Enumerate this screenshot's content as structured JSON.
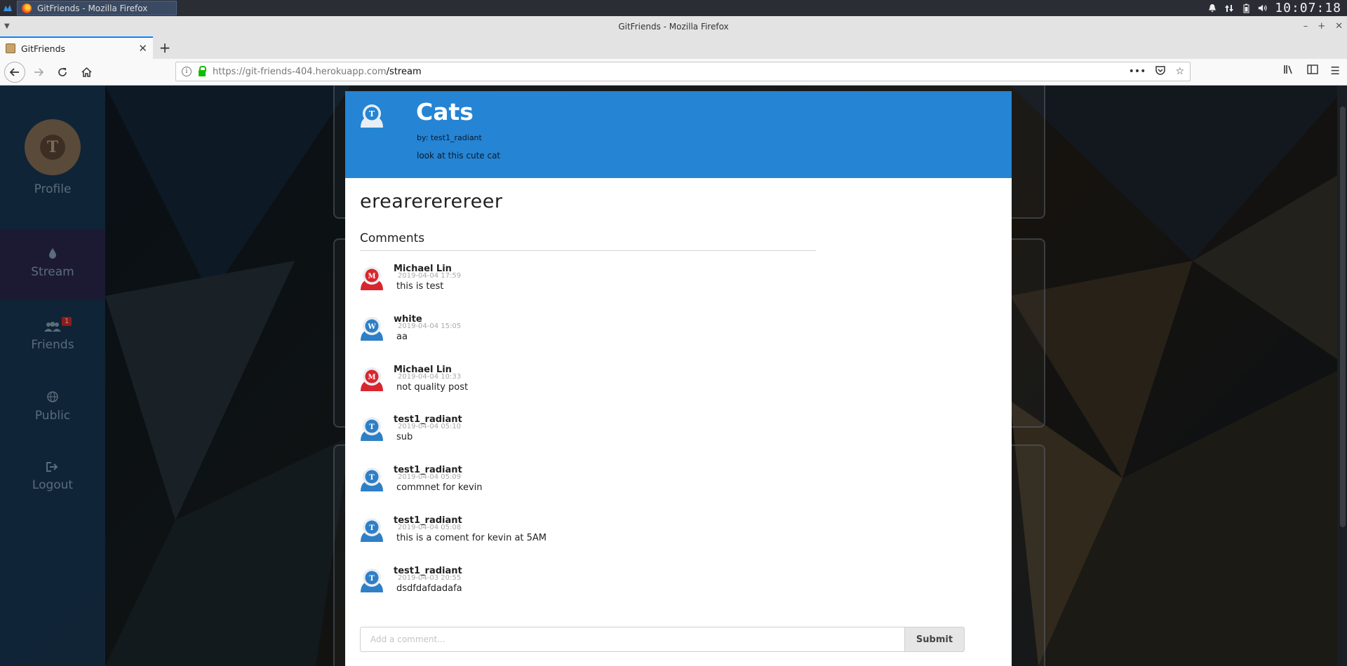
{
  "os": {
    "task_title": "GitFriends - Mozilla Firefox",
    "clock": "10:07:18",
    "icons": [
      "menu-icon",
      "bell-icon",
      "network-arrows-icon",
      "battery-icon",
      "volume-icon"
    ]
  },
  "browser": {
    "window_title": "GitFriends - Mozilla Firefox",
    "tab_title": "GitFriends",
    "url_host": "https://git-friends-404.herokuapp.com",
    "url_path": "/stream",
    "new_tab_label": "+"
  },
  "sidebar": {
    "profile_initial": "T",
    "items": [
      {
        "label": "Profile"
      },
      {
        "label": "Stream",
        "active": true
      },
      {
        "label": "Friends",
        "badge": "1"
      },
      {
        "label": "Public"
      },
      {
        "label": "Logout"
      }
    ]
  },
  "post": {
    "author_initial": "T",
    "title": "Cats",
    "by": "by: test1_radiant",
    "description": "look at this cute cat",
    "content": "erearererereer"
  },
  "comments": {
    "heading": "Comments",
    "items": [
      {
        "author": "Michael Lin",
        "initial": "M",
        "color": "#d9262d",
        "date": "2019-04-04 17:59",
        "text": "this is test"
      },
      {
        "author": "white",
        "initial": "W",
        "color": "#2e7fc6",
        "date": "2019-04-04 15:05",
        "text": "aa"
      },
      {
        "author": "Michael Lin",
        "initial": "M",
        "color": "#d9262d",
        "date": "2019-04-04 10:33",
        "text": "not quality post"
      },
      {
        "author": "test1_radiant",
        "initial": "T",
        "color": "#2e7fc6",
        "date": "2019-04-04 05:10",
        "text": "sub"
      },
      {
        "author": "test1_radiant",
        "initial": "T",
        "color": "#2e7fc6",
        "date": "2019-04-04 05:09",
        "text": "commnet for kevin"
      },
      {
        "author": "test1_radiant",
        "initial": "T",
        "color": "#2e7fc6",
        "date": "2019-04-04 05:08",
        "text": "this is a coment for kevin at 5AM"
      },
      {
        "author": "test1_radiant",
        "initial": "T",
        "color": "#2e7fc6",
        "date": "2019-04-03 20:55",
        "text": "dsdfdafdadafa"
      }
    ],
    "input_placeholder": "Add a comment...",
    "submit_label": "Submit"
  }
}
